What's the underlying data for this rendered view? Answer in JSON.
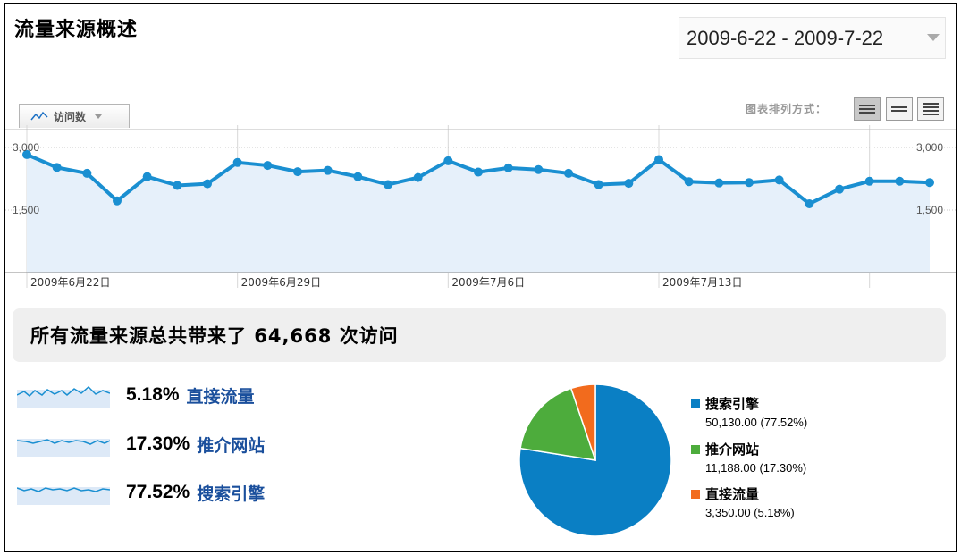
{
  "header": {
    "title": "流量来源概述",
    "date_range": "2009-6-22 - 2009-7-22"
  },
  "toolbar": {
    "metric_tab_label": "访问数",
    "layout_label": "图表排列方式："
  },
  "chart_data": {
    "type": "area",
    "series": [
      {
        "values": [
          2830,
          2520,
          2380,
          1720,
          2300,
          2090,
          2130,
          2640,
          2570,
          2420,
          2450,
          2300,
          2110,
          2280,
          2680,
          2410,
          2510,
          2470,
          2380,
          2110,
          2140,
          2710,
          2180,
          2150,
          2160,
          2220,
          1650,
          2000,
          2190,
          2190,
          2160
        ]
      }
    ],
    "x_tick_labels": [
      "2009年6月22日",
      "2009年6月29日",
      "2009年7月6日",
      "2009年7月13日"
    ],
    "y_tick_labels": [
      "3,000",
      "1,500"
    ],
    "ylim": [
      0,
      3000
    ],
    "grid": true,
    "color": "#1a8fd1"
  },
  "summary": {
    "text": "所有流量来源总共带来了 64,668 次访问"
  },
  "sources": [
    {
      "pct": "5.18%",
      "label": "直接流量"
    },
    {
      "pct": "17.30%",
      "label": "推介网站"
    },
    {
      "pct": "77.52%",
      "label": "搜索引擎"
    }
  ],
  "pie": {
    "slices": [
      {
        "name": "搜索引擎",
        "value": 50130,
        "percent": 77.52,
        "color": "#0a7fc4"
      },
      {
        "name": "推介网站",
        "value": 11188,
        "percent": 17.3,
        "color": "#4dac3c"
      },
      {
        "name": "直接流量",
        "value": 3350,
        "percent": 5.18,
        "color": "#f26b1d"
      }
    ],
    "legend": [
      {
        "name": "搜索引擎",
        "detail": "50,130.00 (77.52%)",
        "color": "#0a7fc4"
      },
      {
        "name": "推介网站",
        "detail": "11,188.00 (17.30%)",
        "color": "#4dac3c"
      },
      {
        "name": "直接流量",
        "detail": "3,350.00 (5.18%)",
        "color": "#f26b1d"
      }
    ]
  }
}
